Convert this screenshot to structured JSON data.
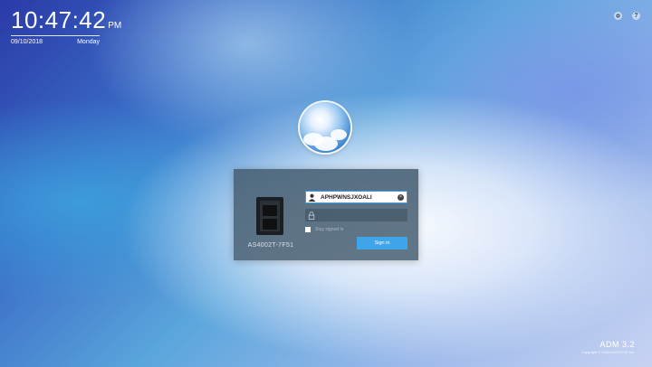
{
  "clock": {
    "time": "10:47:42",
    "ampm": "PM",
    "date": "09/10/2018",
    "weekday": "Monday"
  },
  "top_icons": [
    "gear-icon",
    "help-icon"
  ],
  "login": {
    "device_name": "AS4002T-7F51",
    "username_value": "APHPWNSJXOALI",
    "password_value": "",
    "stay_signed_in_label": "Stay signed in",
    "sign_in_label": "Sign in",
    "help_glyph": "?"
  },
  "footer": {
    "version": "ADM 3.2",
    "copyright": "Copyright © 2018 ASUSTOR Inc."
  },
  "colors": {
    "accent": "#3fa5ea",
    "panel": "#4d6678"
  }
}
